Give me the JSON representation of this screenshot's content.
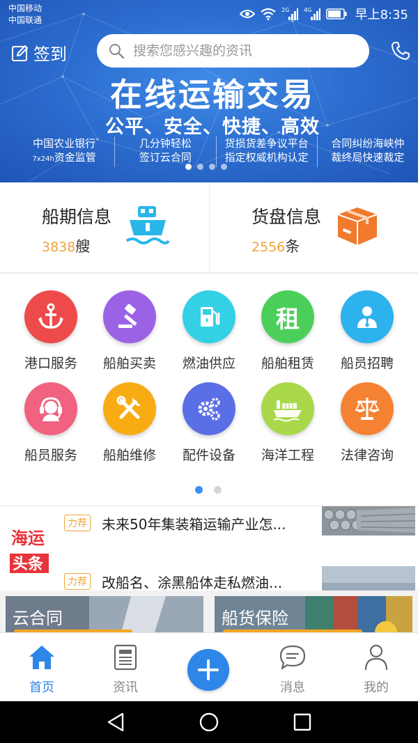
{
  "status_bar": {
    "carrier_1": "中国移动",
    "carrier_2": "中国联通",
    "net_2g": "2G",
    "net_4g": "4G",
    "time": "早上8:35"
  },
  "header": {
    "signin_label": "签到",
    "search_placeholder": "搜索您感兴趣的资讯"
  },
  "banner": {
    "title": "在线运输交易",
    "subtitle": "公平、安全、快捷、高效",
    "features": [
      {
        "line1": "中国农业银行",
        "line2_small": "7x24h",
        "line2": "资金监管"
      },
      {
        "line1": "几分钟轻松",
        "line2_small": "",
        "line2": "签订云合同"
      },
      {
        "line1": "货损货差争议平台",
        "line2_small": "",
        "line2": "指定权威机构认定"
      },
      {
        "line1": "合同纠纷海峡仲",
        "line2_small": "",
        "line2": "裁终局快速裁定"
      }
    ]
  },
  "info_cards": [
    {
      "title": "船期信息",
      "count": "3838",
      "unit": "艘",
      "icon": "ship-icon",
      "color": "#29b6e8"
    },
    {
      "title": "货盘信息",
      "count": "2556",
      "unit": "条",
      "icon": "box-icon",
      "color": "#f07a2e"
    }
  ],
  "services": [
    {
      "label": "港口服务",
      "icon": "anchor-icon",
      "color": "#ee4a4a"
    },
    {
      "label": "船舶买卖",
      "icon": "gavel-icon",
      "color": "#9b62e6"
    },
    {
      "label": "燃油供应",
      "icon": "fuel-pump-icon",
      "color": "#33d0e6"
    },
    {
      "label": "船舶租赁",
      "icon": "rent-icon",
      "color": "#4bcf5a"
    },
    {
      "label": "船员招聘",
      "icon": "recruit-person-icon",
      "color": "#2eb2ee"
    },
    {
      "label": "船员服务",
      "icon": "headset-icon",
      "color": "#f06280"
    },
    {
      "label": "船舶维修",
      "icon": "tools-icon",
      "color": "#f7ac14"
    },
    {
      "label": "配件设备",
      "icon": "gears-icon",
      "color": "#5a6ee6"
    },
    {
      "label": "海洋工程",
      "icon": "vessel-icon",
      "color": "#a9d94a"
    },
    {
      "label": "法律咨询",
      "icon": "scales-icon",
      "color": "#f58232"
    }
  ],
  "rent_glyph": "租",
  "news": {
    "logo_line1": "海运",
    "logo_line2": "头条",
    "items": [
      {
        "tag": "力荐",
        "headline": "未来50年集装箱运输产业怎..."
      },
      {
        "tag": "力荐",
        "headline": "改船名、涂黑船体走私燃油..."
      }
    ]
  },
  "promos": [
    {
      "label": "云合同"
    },
    {
      "label": "船货保险"
    }
  ],
  "tabbar": [
    {
      "label": "首页",
      "icon": "home-icon",
      "active": true
    },
    {
      "label": "资讯",
      "icon": "news-doc-icon",
      "active": false
    },
    {
      "label": "消息",
      "icon": "chat-bubble-icon",
      "active": false
    },
    {
      "label": "我的",
      "icon": "person-icon",
      "active": false
    }
  ],
  "colors": {
    "accent": "#2e86e8",
    "count_orange": "#f0a33a",
    "banner_blue": "#2d6fd1"
  }
}
